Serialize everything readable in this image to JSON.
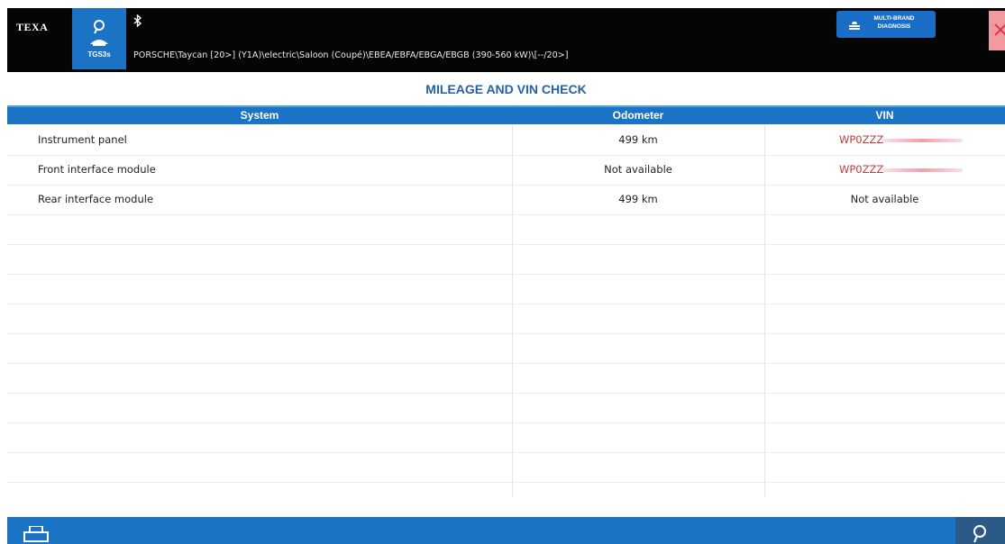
{
  "header": {
    "logo": "TEXA",
    "device_label": "TGS3s",
    "vehicle_path": "PORSCHE\\Taycan [20>] (Y1A)\\electric\\Saloon (Coupé)\\EBEA/EBFA/EBGA/EBGB (390-560 kW)\\[--/20>]",
    "multibrand_line1": "MULTI-BRAND",
    "multibrand_line2": "DIAGNOSIS"
  },
  "title": "MILEAGE AND VIN CHECK",
  "table": {
    "headers": {
      "system": "System",
      "odometer": "Odometer",
      "vin": "VIN"
    },
    "rows": [
      {
        "system": "Instrument panel",
        "odometer": "499 km",
        "vin": "WP0ZZZ"
      },
      {
        "system": "Front interface module",
        "odometer": "Not available",
        "vin": "WP0ZZZ"
      },
      {
        "system": "Rear interface module",
        "odometer": "499 km",
        "vin": "Not available"
      }
    ]
  },
  "colors": {
    "accent_blue": "#1a73c4",
    "title_blue": "#2560a8",
    "vin_red": "#c33b3b",
    "close_pink": "#f29aa0"
  },
  "icons": {
    "device": "user-search-icon",
    "bluetooth": "bluetooth-icon",
    "multibrand": "car-lift-icon",
    "close": "close-icon",
    "print": "printer-icon",
    "search": "search-icon"
  }
}
